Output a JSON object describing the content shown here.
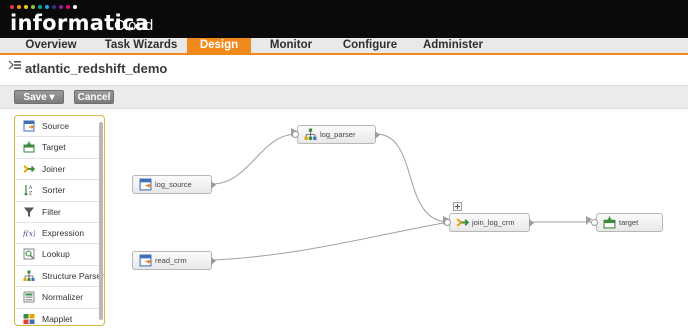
{
  "header": {
    "logo_text": "informatica",
    "logo_suffix": "Cloud",
    "logo_dot_colors": [
      "#e83a2e",
      "#f7941d",
      "#f6c21c",
      "#8dc63f",
      "#00a79d",
      "#27aae1",
      "#2e3192",
      "#92278f",
      "#ec008c",
      "#ffffff"
    ]
  },
  "nav": {
    "items": [
      "Overview",
      "Task Wizards",
      "Design",
      "Monitor",
      "Configure",
      "Administer"
    ],
    "active": "Design",
    "accent_color": "#f08a1d"
  },
  "page": {
    "title": "atlantic_redshift_demo"
  },
  "toolbar": {
    "save_label": "Save ▾",
    "cancel_label": "Cancel"
  },
  "palette": {
    "items": [
      {
        "label": "Source",
        "icon": "source-icon"
      },
      {
        "label": "Target",
        "icon": "target-icon"
      },
      {
        "label": "Joiner",
        "icon": "joiner-icon"
      },
      {
        "label": "Sorter",
        "icon": "sorter-icon"
      },
      {
        "label": "Filter",
        "icon": "filter-icon"
      },
      {
        "label": "Expression",
        "icon": "expression-icon"
      },
      {
        "label": "Lookup",
        "icon": "lookup-icon"
      },
      {
        "label": "Structure Parser",
        "icon": "structure-parser-icon"
      },
      {
        "label": "Normalizer",
        "icon": "normalizer-icon"
      },
      {
        "label": "Mapplet",
        "icon": "mapplet-icon"
      }
    ]
  },
  "mapping": {
    "nodes": [
      {
        "id": "log_source",
        "label": "log_source",
        "icon": "source-icon"
      },
      {
        "id": "read_crm",
        "label": "read_crm",
        "icon": "source-icon"
      },
      {
        "id": "log_parser",
        "label": "log_parser",
        "icon": "structure-parser-icon"
      },
      {
        "id": "join_log_crm",
        "label": "join_log_crm",
        "icon": "joiner-icon"
      },
      {
        "id": "target",
        "label": "target",
        "icon": "target-icon"
      }
    ]
  }
}
